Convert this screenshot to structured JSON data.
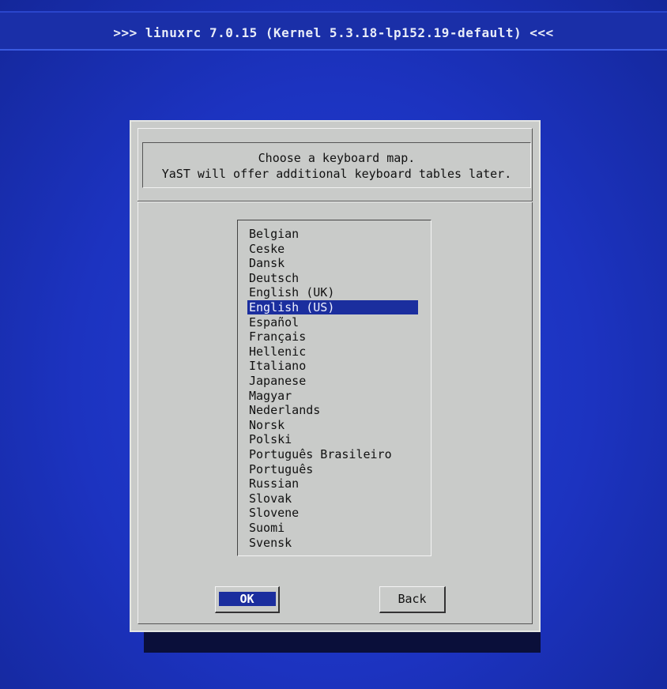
{
  "header": {
    "title": ">>> linuxrc 7.0.15 (Kernel 5.3.18-lp152.19-default) <<<"
  },
  "dialog": {
    "message_line1": "Choose a keyboard map.",
    "message_line2": "YaST will offer additional keyboard tables later.",
    "keyboard_maps": [
      "Belgian",
      "Ceske",
      "Dansk",
      "Deutsch",
      "English (UK)",
      "English (US)",
      "Español",
      "Français",
      "Hellenic",
      "Italiano",
      "Japanese",
      "Magyar",
      "Nederlands",
      "Norsk",
      "Polski",
      "Português Brasileiro",
      "Português",
      "Russian",
      "Slovak",
      "Slovene",
      "Suomi",
      "Svensk"
    ],
    "selected_index": 5,
    "ok_label": "OK",
    "back_label": "Back"
  },
  "colors": {
    "background": "#1c33b8",
    "dialog": "#c9cbc9",
    "selection": "#1b2e9e"
  }
}
